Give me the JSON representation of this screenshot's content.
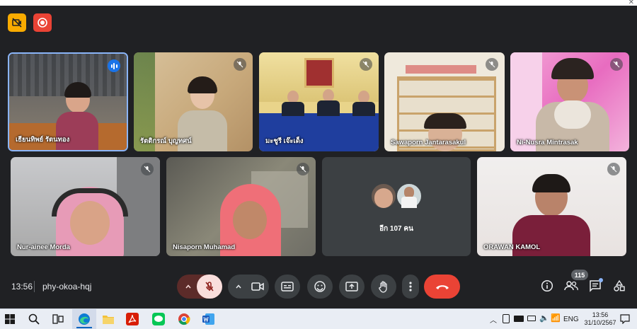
{
  "meeting": {
    "time": "13:56",
    "code": "phy-okoa-hqj",
    "participant_count": "115"
  },
  "participants": [
    {
      "name": "เธียนทิพย์ รัตนทอง",
      "muted": false
    },
    {
      "name": "รัตติกรณ์ บุญทศน์",
      "muted": true
    },
    {
      "name": "มะชูรี เจ๊ะเด็ง",
      "muted": true
    },
    {
      "name": "Sawaporn Jantarasakul",
      "muted": true
    },
    {
      "name": "Ni-Nusra Mintrasak",
      "muted": true
    },
    {
      "name": "Nur-ainee Morda",
      "muted": true
    },
    {
      "name": "Nisaporn Muhamad",
      "muted": true
    },
    {
      "name": "อีก 107 คน",
      "muted": true
    },
    {
      "name": "ORAWAN KAMOL",
      "muted": true
    }
  ],
  "taskbar": {
    "language": "ENG",
    "clock_time": "13:56",
    "clock_date": "31/10/2567"
  },
  "colors": {
    "background": "#202124",
    "control": "#3c4043",
    "leave_red": "#ea4335",
    "mic_off_pink": "#f9dedc",
    "speaking_blue": "#1a73e8"
  }
}
